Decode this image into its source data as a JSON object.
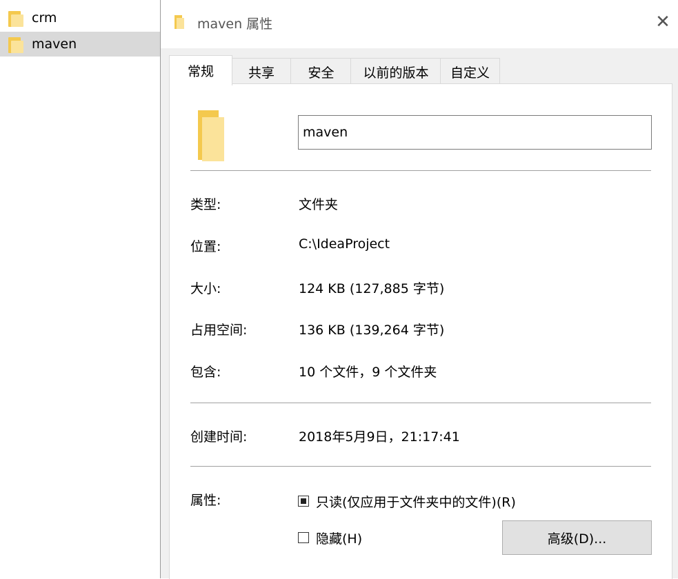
{
  "explorer": {
    "items": [
      {
        "label": "crm"
      },
      {
        "label": "maven"
      }
    ]
  },
  "dialog": {
    "title": "maven 属性",
    "tabs": [
      "常规",
      "共享",
      "安全",
      "以前的版本",
      "自定义"
    ],
    "folder_name": "maven",
    "props": {
      "type_label": "类型:",
      "type_value": "文件夹",
      "location_label": "位置:",
      "location_value": "C:\\IdeaProject",
      "size_label": "大小:",
      "size_value": "124 KB (127,885 字节)",
      "disk_label": "占用空间:",
      "disk_value": "136 KB (139,264 字节)",
      "contains_label": "包含:",
      "contains_value": "10 个文件，9 个文件夹",
      "created_label": "创建时间:",
      "created_value": "2018年5月9日，21:17:41",
      "attrs_label": "属性:"
    },
    "attributes": {
      "readonly_label": "只读(仅应用于文件夹中的文件)(R)",
      "hidden_label": "隐藏(H)",
      "advanced_button": "高级(D)..."
    }
  }
}
